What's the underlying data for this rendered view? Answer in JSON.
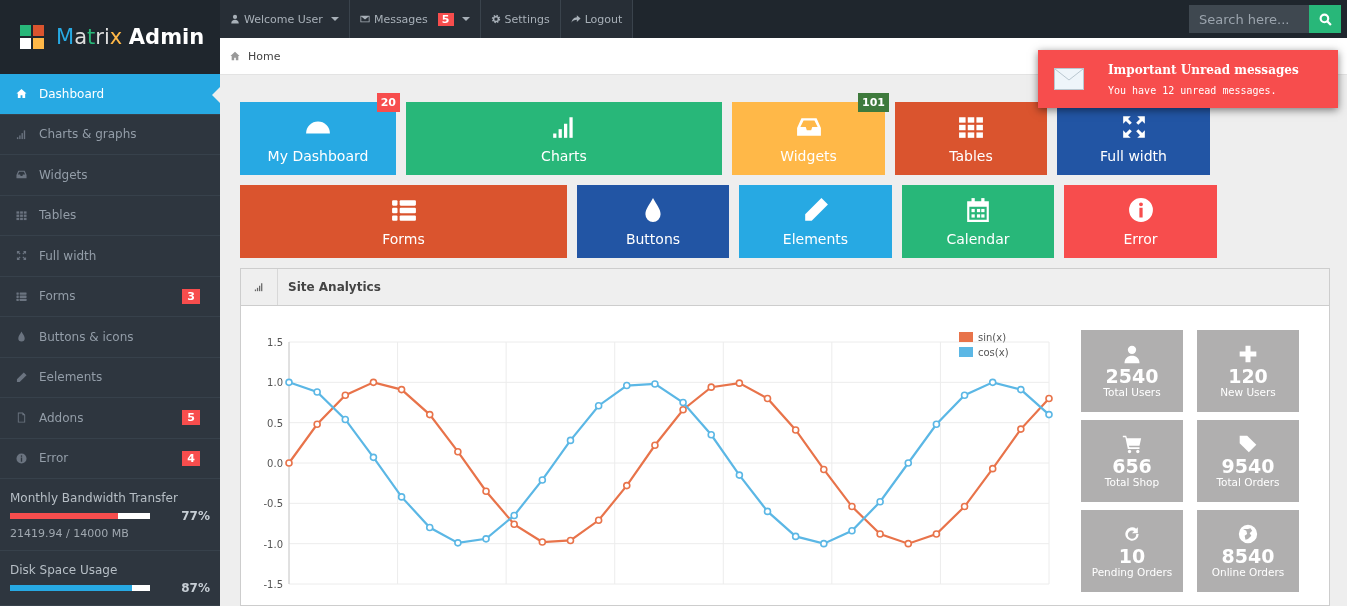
{
  "logo": {
    "word1": "Matrix",
    "word2": "Admin"
  },
  "topnav": {
    "items": [
      {
        "label": "Welcome User",
        "caret": true
      },
      {
        "label": "Messages",
        "badge": "5",
        "caret": true
      },
      {
        "label": "Settings",
        "caret": false
      },
      {
        "label": "Logout",
        "caret": false
      }
    ],
    "search": {
      "placeholder": "Search here..."
    }
  },
  "breadcrumb": {
    "label": "Home"
  },
  "notification": {
    "title": "Important Unread messages",
    "text": "You have 12 unread messages."
  },
  "sidebar": {
    "items": [
      {
        "label": "Dashboard",
        "selected": true
      },
      {
        "label": "Charts & graphs",
        "selected": false
      },
      {
        "label": "Widgets",
        "selected": false
      },
      {
        "label": "Tables",
        "selected": false
      },
      {
        "label": "Full width",
        "selected": false
      },
      {
        "label": "Forms",
        "selected": false,
        "badge": "3"
      },
      {
        "label": "Buttons & icons",
        "selected": false
      },
      {
        "label": "Eelements",
        "selected": false
      },
      {
        "label": "Addons",
        "selected": false,
        "badge": "5"
      },
      {
        "label": "Error",
        "selected": false,
        "badge": "4"
      }
    ],
    "meters": [
      {
        "title": "Monthly Bandwidth Transfer",
        "level": 0.77,
        "reading": "77%",
        "detail": "21419.94 / 14000 MB",
        "color": "#f74d4d"
      },
      {
        "title": "Disk Space Usage",
        "level": 0.87,
        "reading": "87%",
        "color": "#27a9e3"
      }
    ]
  },
  "tiles": [
    [
      {
        "label": "My Dashboard",
        "color": "#27a9e3",
        "badge": {
          "text": "20",
          "color": "#f74d4d"
        }
      },
      {
        "label": "Charts",
        "color": "#28b779"
      },
      {
        "label": "Widgets",
        "color": "#ffb848",
        "badge": {
          "text": "101",
          "color": "#3e7a3c"
        }
      },
      {
        "label": "Tables",
        "color": "#da542e"
      },
      {
        "label": "Full width",
        "color": "#2255a4"
      }
    ],
    [
      {
        "label": "Forms",
        "color": "#da542e"
      },
      {
        "label": "Buttons",
        "color": "#2255a4"
      },
      {
        "label": "Elements",
        "color": "#27a9e3"
      },
      {
        "label": "Calendar",
        "color": "#28b779"
      },
      {
        "label": "Error",
        "color": "#f74d4d"
      }
    ]
  ],
  "analytics": {
    "title": "Site Analytics",
    "chart_data": {
      "type": "line",
      "grid": true,
      "legend": "top-right",
      "ylim": [
        -1.5,
        1.5
      ],
      "yticks": [
        {
          "value": -1.5,
          "label": "-1.5"
        },
        {
          "value": -1,
          "label": "-1.0"
        },
        {
          "value": -0.5,
          "label": "-0.5"
        },
        {
          "value": 0,
          "label": "0.0"
        },
        {
          "value": 0.5,
          "label": "0.5"
        },
        {
          "value": 1,
          "label": "1.0"
        },
        {
          "value": 1.5,
          "label": "1.5"
        }
      ],
      "series": [
        {
          "name": "sin(x)",
          "color": "#e8734a",
          "marker": "circle",
          "values": [
            0,
            0.48,
            0.84,
            1,
            0.91,
            0.6,
            0.14,
            -0.35,
            -0.76,
            -0.98,
            -0.96,
            -0.71,
            -0.28,
            0.22,
            0.66,
            0.94,
            0.99,
            0.8,
            0.41,
            -0.08,
            -0.54,
            -0.88,
            -1,
            -0.88,
            -0.54,
            -0.07,
            0.42,
            0.8
          ]
        },
        {
          "name": "cos(x)",
          "color": "#5bb7e5",
          "marker": "circle",
          "values": [
            1,
            0.88,
            0.54,
            0.07,
            -0.42,
            -0.8,
            -0.99,
            -0.94,
            -0.65,
            -0.21,
            0.28,
            0.71,
            0.96,
            0.98,
            0.75,
            0.35,
            -0.15,
            -0.6,
            -0.91,
            -1,
            -0.84,
            -0.48,
            0,
            0.48,
            0.84,
            1,
            0.91,
            0.6
          ]
        }
      ]
    },
    "stats": [
      {
        "number": "2540",
        "label": "Total Users"
      },
      {
        "number": "120",
        "label": "New Users"
      },
      {
        "number": "656",
        "label": "Total Shop"
      },
      {
        "number": "9540",
        "label": "Total Orders"
      },
      {
        "number": "10",
        "label": "Pending Orders"
      },
      {
        "number": "8540",
        "label": "Online Orders"
      }
    ]
  }
}
